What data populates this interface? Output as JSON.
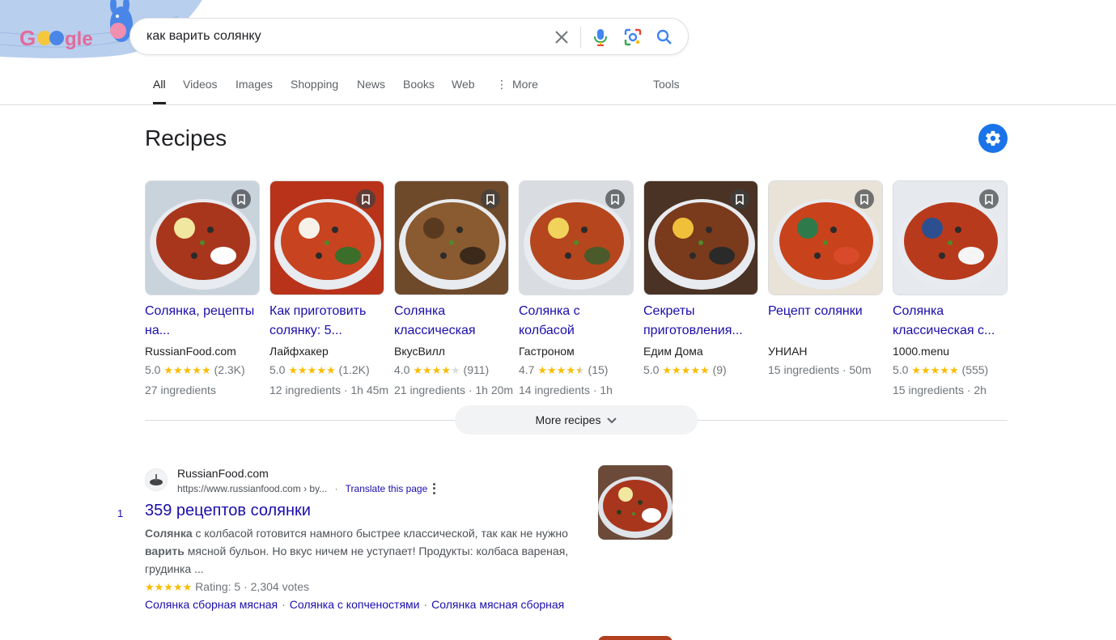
{
  "search": {
    "query": "как варить солянку"
  },
  "tabs": [
    {
      "label": "All",
      "active": true
    },
    {
      "label": "Videos"
    },
    {
      "label": "Images"
    },
    {
      "label": "Shopping"
    },
    {
      "label": "News"
    },
    {
      "label": "Books"
    },
    {
      "label": "Web"
    },
    {
      "label": "More"
    },
    {
      "label": "Tools"
    }
  ],
  "recipes": {
    "title": "Recipes",
    "more_label": "More recipes",
    "cards": [
      {
        "title": "Солянка, рецепты на...",
        "source": "RussianFood.com",
        "rating": "5.0",
        "stars": 5,
        "count": "(2.3K)",
        "meta": "27 ingredients"
      },
      {
        "title": "Как приготовить солянку: 5...",
        "source": "Лайфхакер",
        "rating": "5.0",
        "stars": 5,
        "count": "(1.2K)",
        "meta": "12 ingredients · 1h 45m"
      },
      {
        "title": "Солянка классическая",
        "source": "ВкусВилл",
        "rating": "4.0",
        "stars": 4,
        "count": "(911)",
        "meta": "21 ingredients · 1h 20m"
      },
      {
        "title": "Солянка с колбасой",
        "source": "Гастроном",
        "rating": "4.7",
        "stars": 4.5,
        "count": "(15)",
        "meta": "14 ingredients · 1h"
      },
      {
        "title": "Секреты приготовления...",
        "source": "Едим Дома",
        "rating": "5.0",
        "stars": 5,
        "count": "(9)",
        "meta": ""
      },
      {
        "title": "Рецепт солянки",
        "source": "УНИАН",
        "rating": "",
        "stars": 0,
        "count": "",
        "meta": "15 ingredients · 50m"
      },
      {
        "title": "Солянка классическая с...",
        "source": "1000.menu",
        "rating": "5.0",
        "stars": 5,
        "count": "(555)",
        "meta": "15 ingredients · 2h"
      }
    ]
  },
  "result": {
    "number": "1",
    "site_name": "RussianFood.com",
    "url": "https://www.russianfood.com › by...",
    "translate": "Translate this page",
    "title": "359 рецептов солянки",
    "snippet_parts": [
      {
        "text": "Солянка",
        "bold": true
      },
      {
        "text": " с колбасой готовится намного быстрее классической, так как не нужно ",
        "bold": false
      },
      {
        "text": "варить",
        "bold": true
      },
      {
        "text": " мясной бульон. Но вкус ничем не уступает! Продукты: колбаса вареная, грудинка ...",
        "bold": false
      }
    ],
    "rating_text": "Rating: 5 · 2,304 votes",
    "stars": 5,
    "sitelinks": [
      "Солянка сборная мясная",
      "Солянка с копченостями",
      "Солянка мясная сборная"
    ]
  },
  "icons": {
    "clear": "close-icon",
    "voice": "microphone-icon",
    "lens": "camera-lens-icon",
    "search": "search-icon",
    "settings": "gear-icon",
    "bookmark": "bookmark-icon",
    "more": "chevron-down-icon"
  },
  "colors": {
    "link": "#1a0dab",
    "star": "#fbbc04",
    "accent": "#1a73e8"
  }
}
